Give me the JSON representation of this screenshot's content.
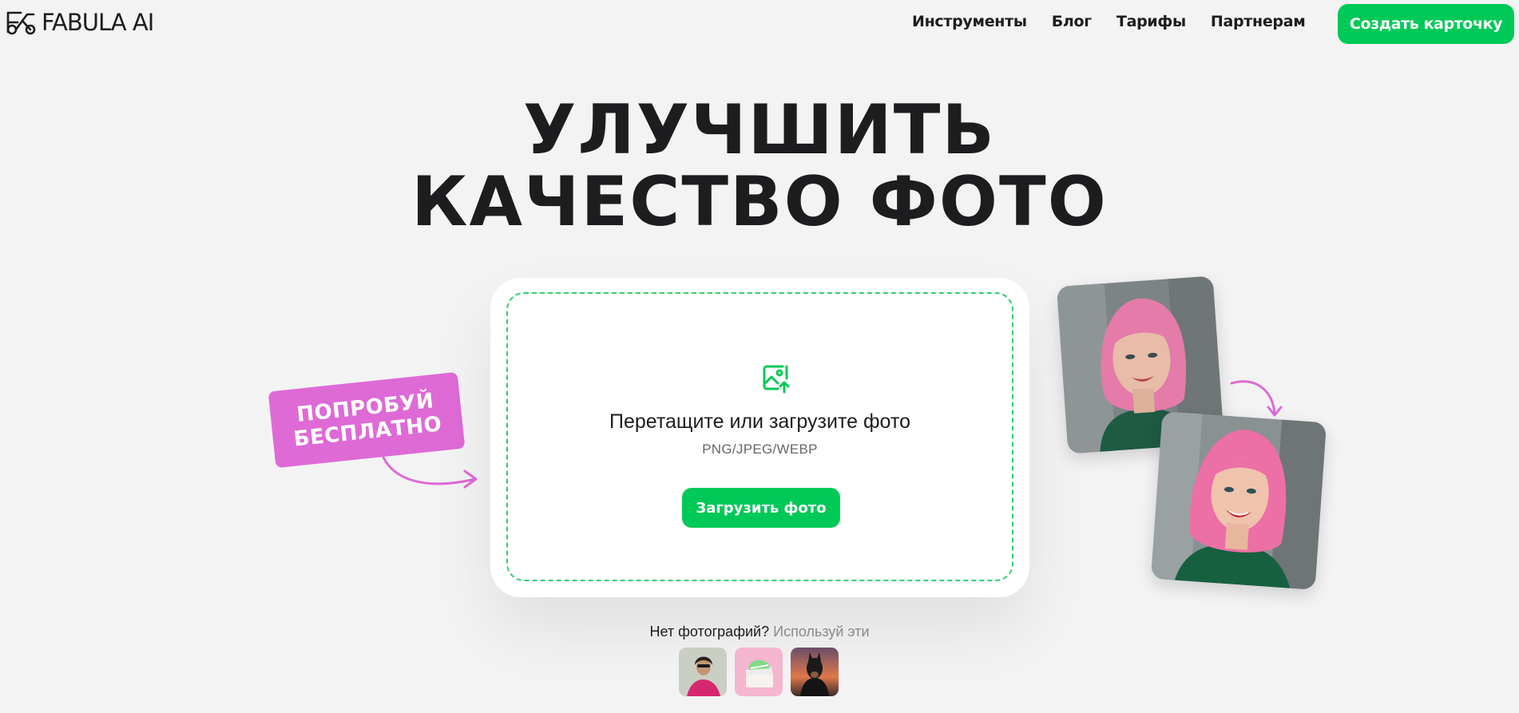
{
  "header": {
    "logo_text": "FABULA AI",
    "nav": [
      "Инструменты",
      "Блог",
      "Тарифы",
      "Партнерам"
    ],
    "cta_label": "Создать карточку"
  },
  "hero": {
    "title_line1": "УЛУЧШИТЬ",
    "title_line2": "КАЧЕСТВО ФОТО"
  },
  "upload": {
    "icon": "image-upload-icon",
    "prompt": "Перетащите или загрузите фото",
    "formats": "PNG/JPEG/WEBP",
    "button_label": "Загрузить фото"
  },
  "sticker": {
    "line1": "ПОПРОБУЙ",
    "line2": "БЕСПЛАТНО"
  },
  "samples": {
    "caption_main": "Нет фотографий?",
    "caption_link": "Используй эти",
    "items": [
      "woman-sample",
      "sneakers-sample",
      "dog-sample"
    ]
  },
  "colors": {
    "accent_green": "#00c957",
    "sticker_pink": "#de6ad6",
    "background": "#f3f3f3",
    "text": "#1d1d1f"
  }
}
